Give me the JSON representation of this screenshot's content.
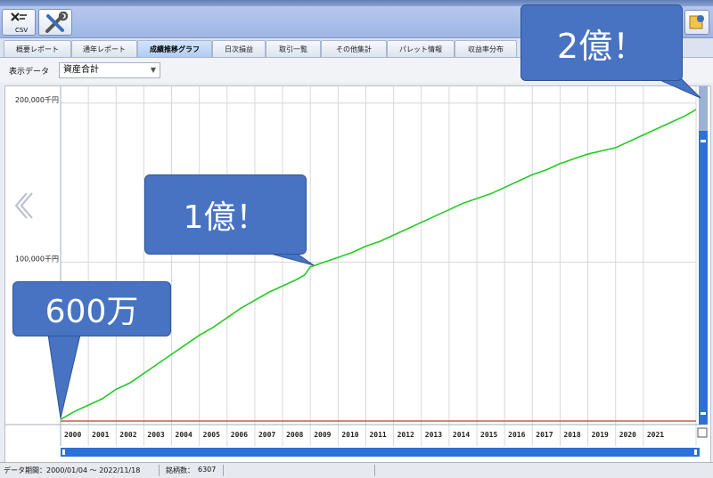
{
  "toolbar": {
    "csv_label": "CSV"
  },
  "tabs": [
    {
      "label": "概要レポート"
    },
    {
      "label": "通年レポート"
    },
    {
      "label": "成績推移グラフ"
    },
    {
      "label": "日次損益"
    },
    {
      "label": "取引一覧"
    },
    {
      "label": "その他集計"
    },
    {
      "label": "パレット情報"
    },
    {
      "label": "収益率分布"
    }
  ],
  "active_tab": "成績推移グラフ",
  "display": {
    "label": "表示データ",
    "selected": "資産合計"
  },
  "chart_data": {
    "type": "line",
    "title": "",
    "xlabel": "",
    "ylabel": "",
    "y_tick_labels": [
      "200,000千円",
      "100,000千円"
    ],
    "y_ticks": [
      200000,
      100000
    ],
    "x_tick_labels": [
      "2000",
      "2001",
      "2002",
      "2003",
      "2004",
      "2005",
      "2006",
      "2007",
      "2008",
      "2009",
      "2010",
      "2011",
      "2012",
      "2013",
      "2014",
      "2015",
      "2016",
      "2017",
      "2018",
      "2019",
      "2020",
      "2021"
    ],
    "xlim": [
      2000,
      2022.9
    ],
    "ylim": [
      0,
      205000
    ],
    "grid": true,
    "series": [
      {
        "color": "#22cc22",
        "x": [
          2000.0,
          2000.5,
          2001.0,
          2001.5,
          2002.0,
          2002.5,
          2003.0,
          2003.5,
          2004.0,
          2004.5,
          2005.0,
          2005.5,
          2006.0,
          2006.5,
          2007.0,
          2007.5,
          2008.0,
          2008.5,
          2008.8,
          2009.0,
          2009.5,
          2010.0,
          2010.5,
          2011.0,
          2011.5,
          2012.0,
          2012.5,
          2013.0,
          2013.5,
          2014.0,
          2014.5,
          2015.0,
          2015.5,
          2016.0,
          2016.5,
          2017.0,
          2017.5,
          2018.0,
          2018.5,
          2019.0,
          2019.5,
          2020.0,
          2020.5,
          2021.0,
          2021.5,
          2022.0,
          2022.5,
          2022.9
        ],
        "y": [
          1000,
          6000,
          10000,
          14000,
          20000,
          24000,
          30000,
          36000,
          42000,
          48000,
          54000,
          59000,
          65000,
          71000,
          76000,
          81000,
          85000,
          89000,
          92000,
          97000,
          100000,
          103000,
          106000,
          110000,
          113000,
          117000,
          121000,
          125000,
          129000,
          133000,
          137000,
          140000,
          143000,
          147000,
          151000,
          155000,
          158000,
          162000,
          165000,
          168000,
          170000,
          172000,
          176000,
          180000,
          184000,
          188000,
          192000,
          196000
        ]
      },
      {
        "color": "#c0392b",
        "x": [
          2000,
          2022.9
        ],
        "y": [
          0,
          0
        ]
      }
    ]
  },
  "annotations": [
    {
      "text": "600万"
    },
    {
      "text": "1億！"
    },
    {
      "text": "2億！"
    }
  ],
  "status": {
    "period_label": "データ期間：",
    "period_value": "2000/01/04 ～ 2022/11/18",
    "count_label": "銘柄数：",
    "count_value": "6307"
  }
}
